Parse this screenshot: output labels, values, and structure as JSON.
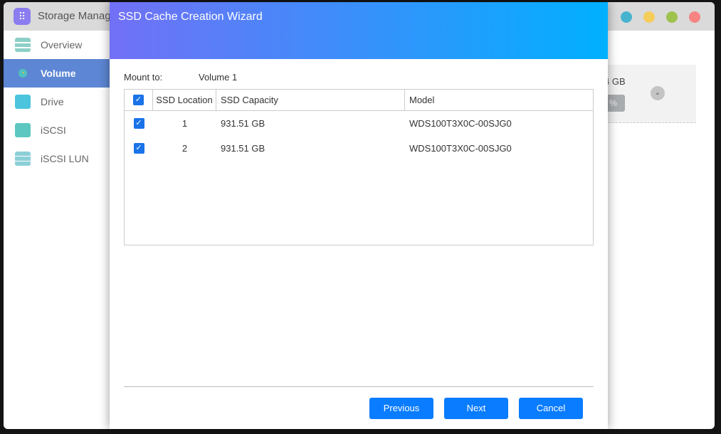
{
  "app": {
    "title": "Storage Manag",
    "window_dots": [
      "#47b3cf",
      "#f5cd5a",
      "#9ec24e",
      "#f78483"
    ]
  },
  "sidebar": {
    "items": [
      {
        "label": "Overview",
        "icon": "overview-icon"
      },
      {
        "label": "Volume",
        "icon": "volume-icon",
        "active": true
      },
      {
        "label": "Drive",
        "icon": "drive-icon"
      },
      {
        "label": "iSCSI",
        "icon": "iscsi-icon"
      },
      {
        "label": "iSCSI LUN",
        "icon": "iscsi-lun-icon"
      }
    ]
  },
  "background_card": {
    "size_text": "4 GB",
    "percent_text": "%"
  },
  "dialog": {
    "title": "SSD Cache Creation Wizard",
    "mount_label": "Mount to:",
    "mount_value": "Volume 1",
    "table": {
      "columns": [
        "SSD Location",
        "SSD Capacity",
        "Model"
      ],
      "rows": [
        {
          "checked": true,
          "location": "1",
          "capacity": "931.51 GB",
          "model": "WDS100T3X0C-00SJG0"
        },
        {
          "checked": true,
          "location": "2",
          "capacity": "931.51 GB",
          "model": "WDS100T3X0C-00SJG0"
        }
      ]
    },
    "buttons": {
      "previous": "Previous",
      "next": "Next",
      "cancel": "Cancel"
    }
  }
}
